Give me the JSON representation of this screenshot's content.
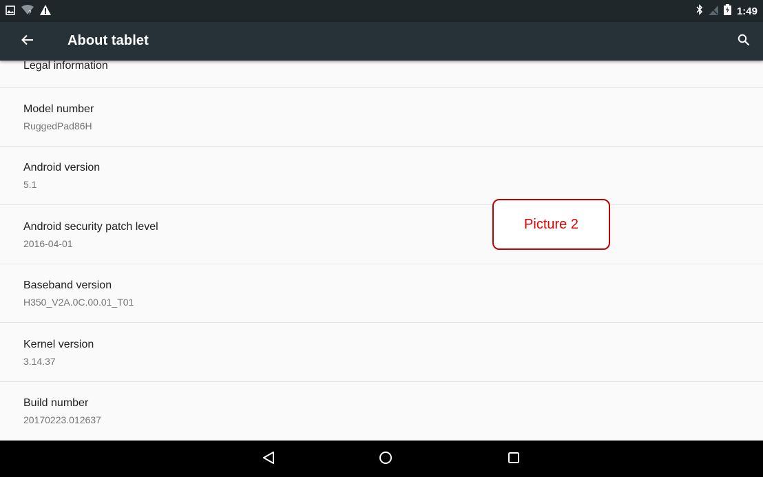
{
  "status_bar": {
    "left_icons": [
      "image-notification-icon",
      "wifi-unknown-icon",
      "warning-icon"
    ],
    "right_icons": [
      "bluetooth-icon",
      "no-signal-icon",
      "battery-charging-icon"
    ],
    "time": "1:49"
  },
  "toolbar": {
    "title": "About tablet",
    "back_icon": "arrow-back-icon",
    "search_icon": "search-icon",
    "background": "#263238"
  },
  "list": {
    "items": [
      {
        "title": "Legal information",
        "summary": ""
      },
      {
        "title": "Model number",
        "summary": "RuggedPad86H"
      },
      {
        "title": "Android version",
        "summary": "5.1"
      },
      {
        "title": "Android security patch level",
        "summary": "2016-04-01"
      },
      {
        "title": "Baseband version",
        "summary": "H350_V2A.0C.00.01_T01"
      },
      {
        "title": "Kernel version",
        "summary": "3.14.37"
      },
      {
        "title": "Build number",
        "summary": "20170223.012637"
      }
    ]
  },
  "annotation": {
    "label": "Picture 2",
    "color": "#e00000"
  },
  "nav_bar": {
    "buttons": [
      "back-triangle-icon",
      "home-circle-icon",
      "recents-square-icon"
    ]
  }
}
